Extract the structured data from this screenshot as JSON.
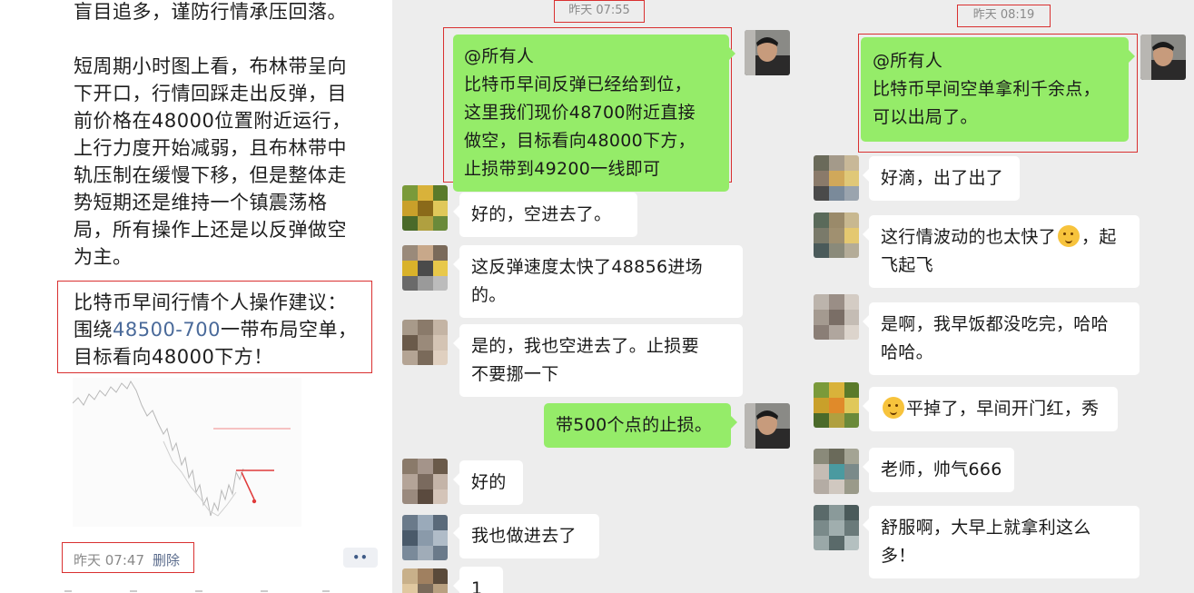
{
  "post": {
    "text_top": "盲目追多，谨防行情承压回落。",
    "text_analysis": "短周期小时图上看，布林带呈向\n下开口，行情回踩走出反弹，目\n前价格在48000位置附近运行，\n上行力度开始减弱，且布林带中\n轨压制在缓慢下移，但是整体走\n势短期还是维持一个镇震荡格\n局，所有操作上还是以反弹做空\n为主。",
    "advice_line1": "比特币早间行情个人操作建议：",
    "advice_line2_prefix": "围绕",
    "advice_line2_highlight": "48500-700",
    "advice_line2_suffix": "一带布局空单，",
    "advice_line3": "目标看向48000下方！",
    "time": "昨天 07:47",
    "delete_label": "删除",
    "more_label": "••"
  },
  "chat1": {
    "timestamp": "昨天 07:55",
    "messages": [
      {
        "side": "out",
        "text": "@所有人\n比特币早间反弹已经给到位，\n这里我们现价48700附近直接\n做空，目标看向48000下方，\n止损带到49200一线即可"
      },
      {
        "side": "in",
        "text": "好的，空进去了。"
      },
      {
        "side": "in",
        "text": "这反弹速度太快了48856进场\n的。"
      },
      {
        "side": "in",
        "text": "是的，我也空进去了。止损要\n不要挪一下"
      },
      {
        "side": "out",
        "text": "带500个点的止损。"
      },
      {
        "side": "in",
        "text": "好的"
      },
      {
        "side": "in",
        "text": "我也做进去了"
      },
      {
        "side": "in",
        "text": "1"
      }
    ]
  },
  "chat2": {
    "timestamp": "昨天 08:19",
    "messages": [
      {
        "side": "out",
        "text": "@所有人\n比特币早间空单拿利千余点，\n可以出局了。"
      },
      {
        "side": "in",
        "text": "好滴，出了出了"
      },
      {
        "side": "in",
        "text_before": "这行情波动的也太快了",
        "text_after": "，起\n飞起飞"
      },
      {
        "side": "in",
        "text": "是啊，我早饭都没吃完，哈哈\n哈哈。"
      },
      {
        "side": "in",
        "text": "平掉了，早间开门红，秀"
      },
      {
        "side": "in",
        "text": "老师，帅气666"
      },
      {
        "side": "in",
        "text": "舒服啊，大早上就拿利这么\n多！"
      }
    ]
  },
  "icons": [
    "avatar-teacher",
    "avatar-member-pixelated",
    "emoji-face"
  ],
  "colors": {
    "chat_bg": "#ededed",
    "bubble_out": "#95ec69",
    "bubble_in": "#ffffff",
    "annotation": "#d93030",
    "highlight": "#4a6a9a"
  }
}
